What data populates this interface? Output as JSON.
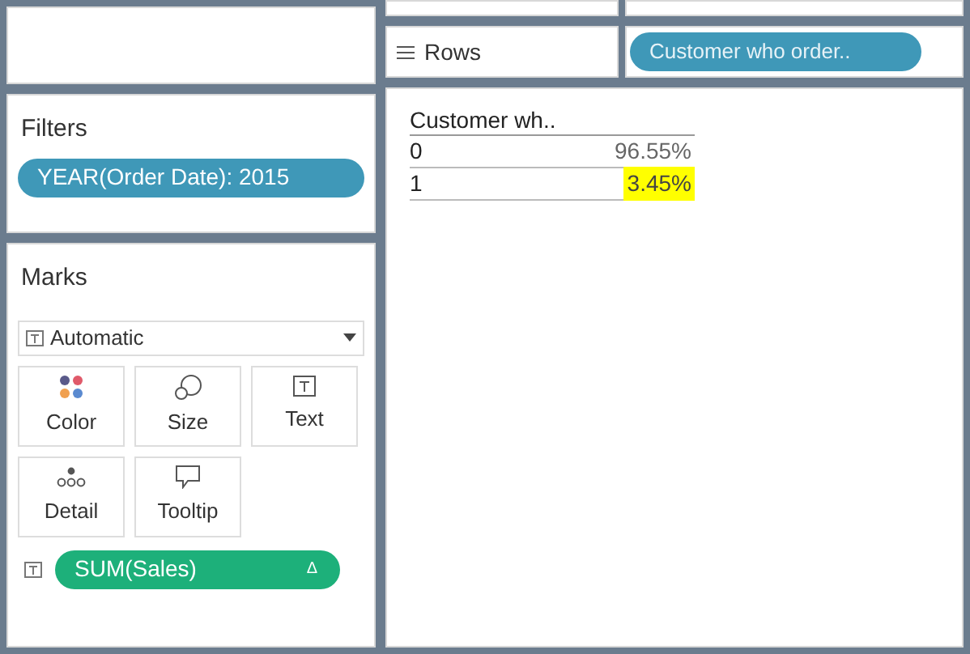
{
  "filters": {
    "title": "Filters",
    "pills": [
      "YEAR(Order Date): 2015"
    ]
  },
  "marks": {
    "title": "Marks",
    "mark_type": "Automatic",
    "cards": [
      {
        "kind": "color",
        "label": "Color"
      },
      {
        "kind": "size",
        "label": "Size"
      },
      {
        "kind": "text",
        "label": "Text"
      },
      {
        "kind": "detail",
        "label": "Detail"
      },
      {
        "kind": "tooltip",
        "label": "Tooltip"
      }
    ],
    "fields": [
      {
        "kind": "text",
        "label": "SUM(Sales)",
        "symbol": "Δ"
      }
    ]
  },
  "rows_shelf": {
    "label": "Rows",
    "pills": [
      "Customer who order.."
    ]
  },
  "table": {
    "header": "Customer wh..",
    "rows": [
      {
        "key": "0",
        "value": "96.55%",
        "highlighted": false
      },
      {
        "key": "1",
        "value": "3.45%",
        "highlighted": true
      }
    ]
  }
}
